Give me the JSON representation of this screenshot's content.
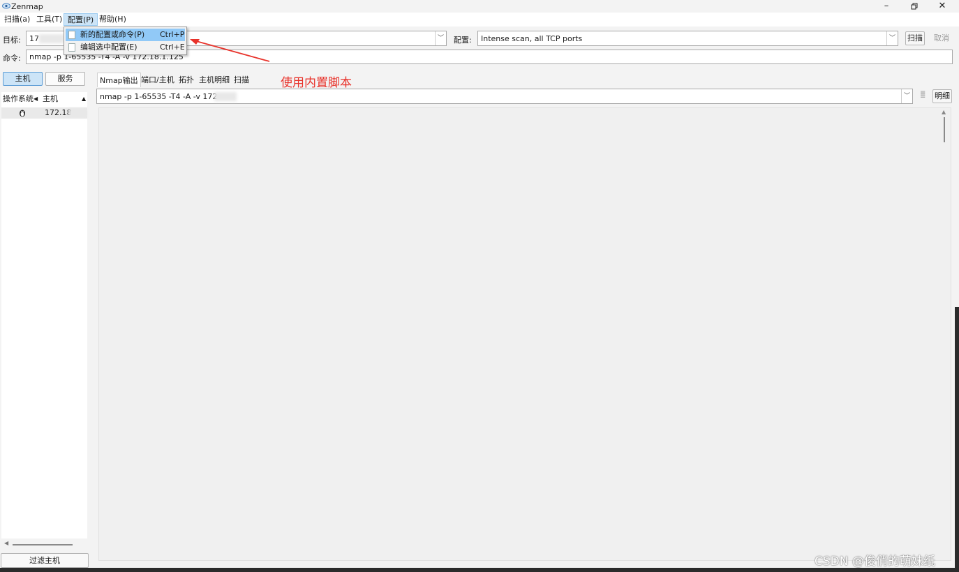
{
  "window": {
    "title": "Zenmap",
    "min_icon": "minimize-icon",
    "max_icon": "restore-icon",
    "close_icon": "close-icon"
  },
  "menubar": {
    "items": [
      {
        "label": "扫描(a)"
      },
      {
        "label": "工具(T)"
      },
      {
        "label": "配置(P)"
      },
      {
        "label": "帮助(H)"
      }
    ]
  },
  "dropdown": {
    "items": [
      {
        "label": "新的配置或命令(P)",
        "accel": "Ctrl+P"
      },
      {
        "label": "编辑选中配置(E)",
        "accel": "Ctrl+E"
      }
    ]
  },
  "target": {
    "label": "目标:",
    "value": "17"
  },
  "profile": {
    "label": "配置:",
    "value": "Intense scan, all TCP ports"
  },
  "buttons": {
    "scan": "扫描",
    "cancel": "取消",
    "detail": "明细",
    "filter": "过滤主机"
  },
  "command": {
    "label": "命令:",
    "value": "nmap -p 1-65535 -T4 -A -v 172.18.1.125"
  },
  "left_panel": {
    "hosts_tab": "主机",
    "services_tab": "服务",
    "col_os": "操作系统",
    "col_host": "主机",
    "host_row": {
      "ip": "172.18"
    }
  },
  "tabs": [
    {
      "label": "Nmap输出"
    },
    {
      "label": "端口/主机"
    },
    {
      "label": "拓扑"
    },
    {
      "label": "主机明细"
    },
    {
      "label": "扫描"
    }
  ],
  "output_selector": {
    "value": "nmap -p 1-65535 -T4 -A -v 172"
  },
  "annotation": "使用内置脚本",
  "watermark": "CSDN @俊俏的萌妹纸",
  "colors": {
    "annotation": "#e8322a",
    "menu_active": "#cce4f7",
    "dropdown_highlight": "#91c9f7"
  }
}
